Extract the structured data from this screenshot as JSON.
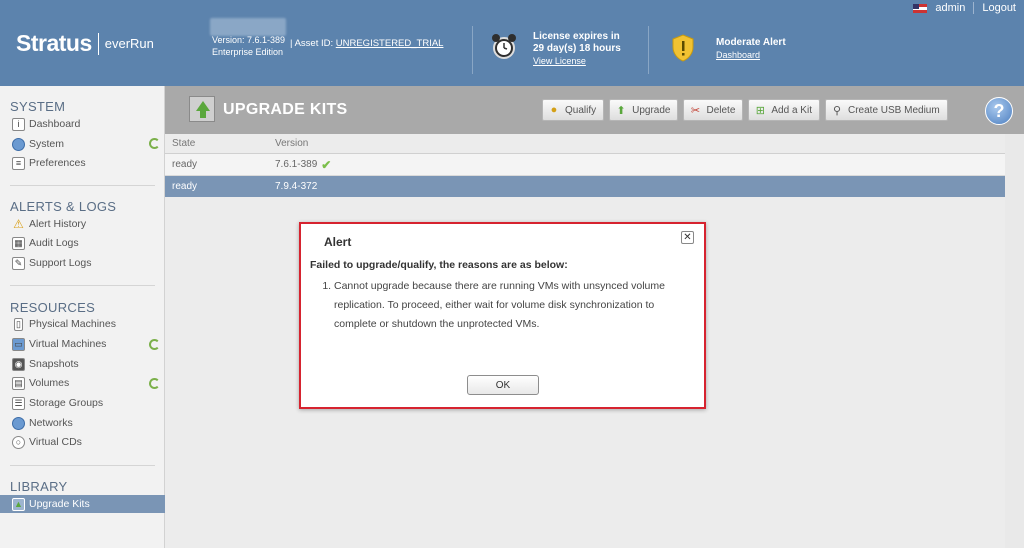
{
  "header": {
    "brand": "Stratus",
    "product": "everRun",
    "version": "Version: 7.6.1-389",
    "edition": "Enterprise Edition",
    "asset_label": "| Asset ID:",
    "asset_id": "UNREGISTERED_TRIAL",
    "license_line1": "License expires in",
    "license_line2": "29 day(s) 18 hours",
    "license_link": "View License",
    "alert_title": "Moderate Alert",
    "alert_link": "Dashboard",
    "user": "admin",
    "logout": "Logout"
  },
  "sidebar": {
    "system_title": "SYSTEM",
    "system_items": [
      {
        "label": "Dashboard",
        "icon": "info-icon"
      },
      {
        "label": "System",
        "icon": "globe-icon"
      },
      {
        "label": "Preferences",
        "icon": "preferences-icon"
      }
    ],
    "alerts_title": "ALERTS & LOGS",
    "alerts_items": [
      {
        "label": "Alert History",
        "icon": "warning-icon"
      },
      {
        "label": "Audit Logs",
        "icon": "calendar-icon"
      },
      {
        "label": "Support Logs",
        "icon": "edit-icon"
      }
    ],
    "resources_title": "RESOURCES",
    "resources_items": [
      {
        "label": "Physical Machines",
        "icon": "server-icon"
      },
      {
        "label": "Virtual Machines",
        "icon": "vm-icon"
      },
      {
        "label": "Snapshots",
        "icon": "camera-icon"
      },
      {
        "label": "Volumes",
        "icon": "volume-icon"
      },
      {
        "label": "Storage Groups",
        "icon": "storage-icon"
      },
      {
        "label": "Networks",
        "icon": "network-icon"
      },
      {
        "label": "Virtual CDs",
        "icon": "cd-icon"
      }
    ],
    "library_title": "LIBRARY",
    "library_items": [
      {
        "label": "Upgrade Kits",
        "icon": "upgrade-kit-icon"
      }
    ]
  },
  "main": {
    "title": "UPGRADE KITS",
    "toolbar": {
      "qualify": "Qualify",
      "upgrade": "Upgrade",
      "delete": "Delete",
      "add_kit": "Add a Kit",
      "create_usb": "Create USB Medium",
      "help": "?"
    },
    "table": {
      "columns": [
        "State",
        "Version"
      ],
      "rows": [
        {
          "state": "ready",
          "version": "7.6.1-389",
          "current": true
        },
        {
          "state": "ready",
          "version": "7.9.4-372",
          "current": false
        }
      ]
    }
  },
  "modal": {
    "title": "Alert",
    "close": "✕",
    "heading": "Failed to upgrade/qualify, the reasons are as below:",
    "reason_1": "Cannot upgrade because there are running VMs with unsynced volume replication. To proceed, either wait for volume disk synchronization to complete or shutdown the unprotected VMs.",
    "ok": "OK"
  },
  "colors": {
    "header": "#5c83ad",
    "selected_row": "#7a95b5",
    "modal_border": "#d6232f",
    "sync_green": "#7bb04a"
  }
}
